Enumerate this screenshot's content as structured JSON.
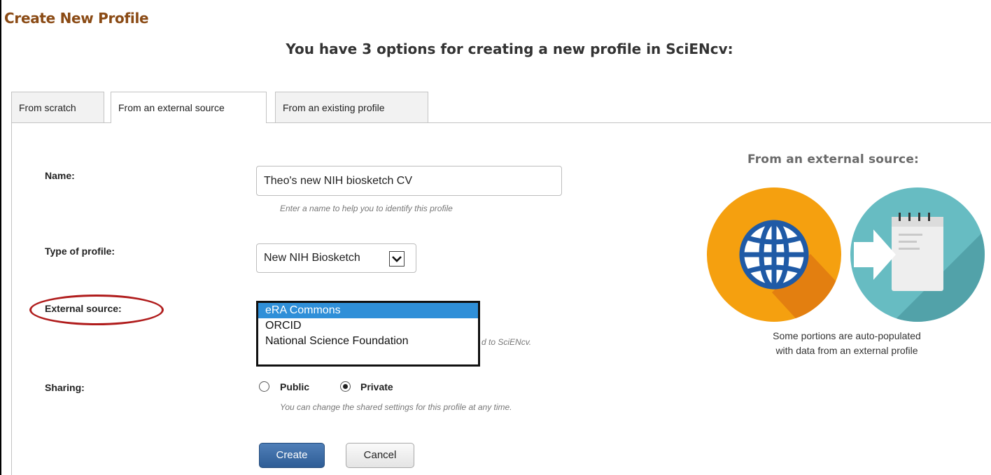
{
  "page": {
    "title": "Create New Profile",
    "subtitle": "You have 3 options for creating a new profile in SciENcv:"
  },
  "tabs": [
    {
      "label": "From scratch",
      "active": false
    },
    {
      "label": "From an external source",
      "active": true
    },
    {
      "label": "From an existing profile",
      "active": false
    }
  ],
  "form": {
    "name_label": "Name:",
    "name_value": "Theo's new NIH biosketch CV",
    "name_hint": "Enter a name to help you to identify this profile",
    "type_label": "Type of profile:",
    "type_value": "New NIH Biosketch",
    "external_label": "External source:",
    "external_options": [
      "eRA Commons",
      "ORCID",
      "National Science Foundation"
    ],
    "external_selected": "eRA Commons",
    "external_hint_visible": "d to SciENcv.",
    "sharing_label": "Sharing:",
    "sharing_public": "Public",
    "sharing_private": "Private",
    "sharing_selected": "Private",
    "sharing_hint": "You can change the shared settings for this profile at any time.",
    "create_label": "Create",
    "cancel_label": "Cancel"
  },
  "side": {
    "heading": "From an external source:",
    "caption_line1": "Some portions are auto-populated",
    "caption_line2": "with data from an external profile"
  },
  "colors": {
    "title": "#8a4a14",
    "highlight_ellipse": "#b01c1c",
    "selected_option": "#2f8fd8",
    "create_button": "#2e5d96",
    "illustration_orange": "#f5a00f",
    "illustration_teal": "#67bcc2"
  },
  "icons": [
    "globe-icon",
    "arrow-right-icon",
    "notepad-icon",
    "chevron-down-icon"
  ]
}
